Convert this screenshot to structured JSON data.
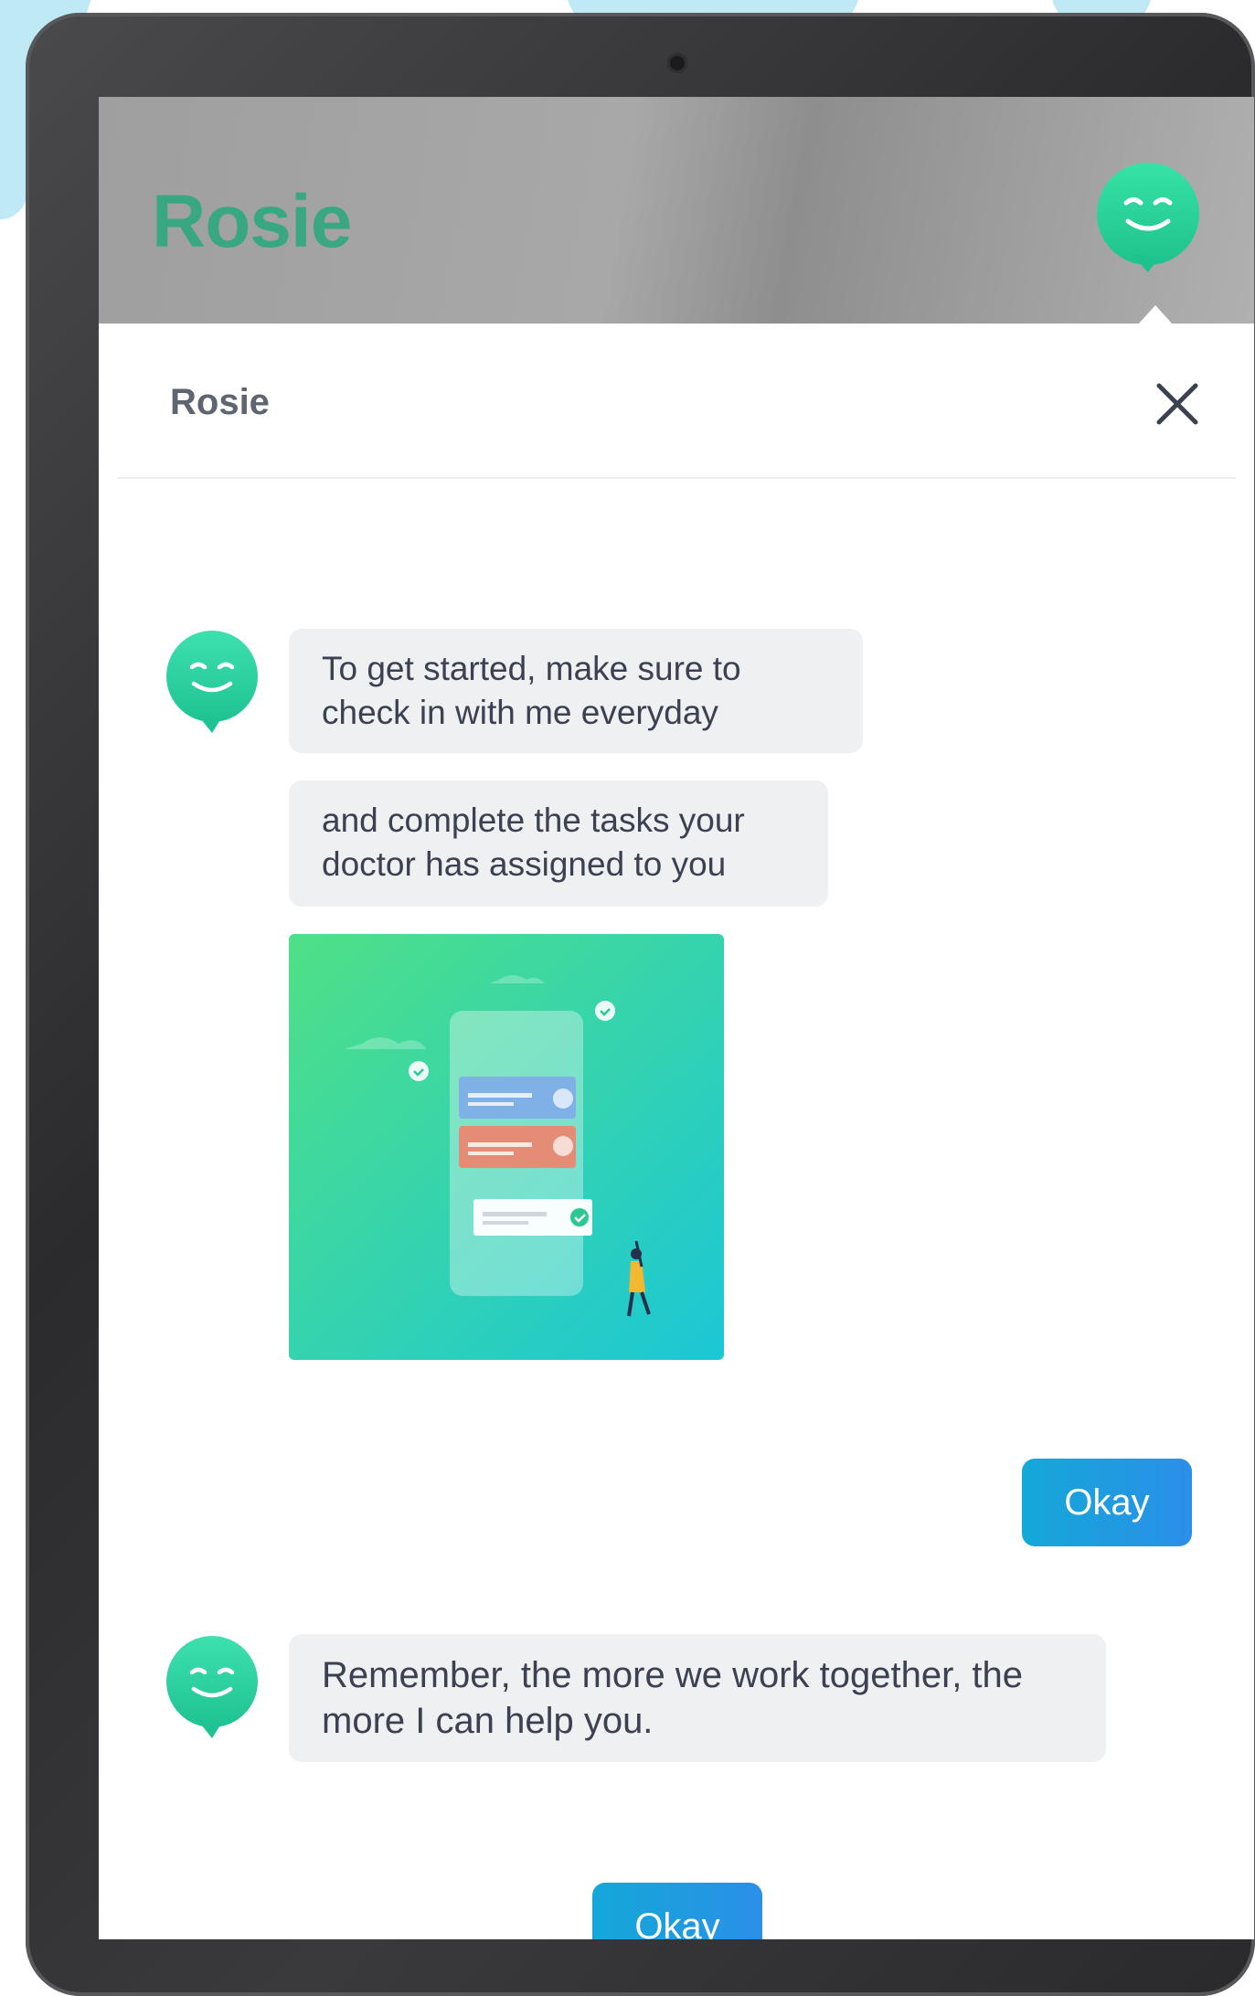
{
  "app": {
    "logo_text": "Rosie",
    "brand_color": "#3aa783",
    "avatar_icon": "smiley-chat-bubble-icon"
  },
  "chat_panel": {
    "title": "Rosie",
    "close_icon": "close-icon"
  },
  "messages": [
    {
      "sender": "bot",
      "text": "To get started, make sure to check in with me everyday"
    },
    {
      "sender": "bot",
      "text": "and complete the tasks your doctor has assigned to you"
    },
    {
      "sender": "bot",
      "type": "image",
      "image_icon": "task-checklist-illustration"
    },
    {
      "sender": "user-reply",
      "button_label": "Okay"
    },
    {
      "sender": "bot",
      "text": "Remember, the more we work together, the more I can help you."
    }
  ],
  "footer_reply": {
    "button_label": "Okay"
  },
  "colors": {
    "accent_green": "#2fd29a",
    "button_blue": "#1ea0e0",
    "bubble_bg": "#eef0f2"
  }
}
